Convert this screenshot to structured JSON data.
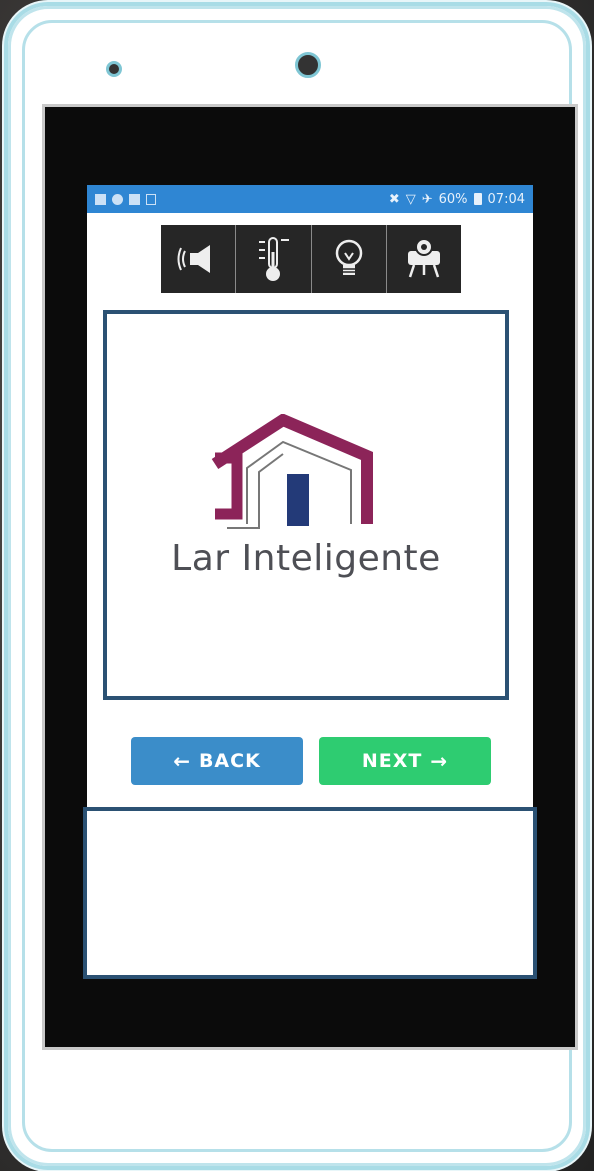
{
  "status_bar": {
    "battery_percent": "60%",
    "time": "07:04"
  },
  "toolbar": {
    "items": [
      {
        "icon": "speaker-icon"
      },
      {
        "icon": "thermometer-icon"
      },
      {
        "icon": "lightbulb-icon"
      },
      {
        "icon": "projector-icon"
      }
    ]
  },
  "logo": {
    "brand_name": "Lar Inteligente",
    "colors": {
      "roof": "#8c2459",
      "door": "#233a78",
      "outline": "#777777"
    }
  },
  "nav": {
    "back_label": "BACK",
    "next_label": "NEXT"
  },
  "colors": {
    "status_bar": "#2f86d3",
    "back_button": "#3b8dc9",
    "next_button": "#2ecc71",
    "frame_border": "#2b5173",
    "device_accent": "#a9dce6"
  }
}
